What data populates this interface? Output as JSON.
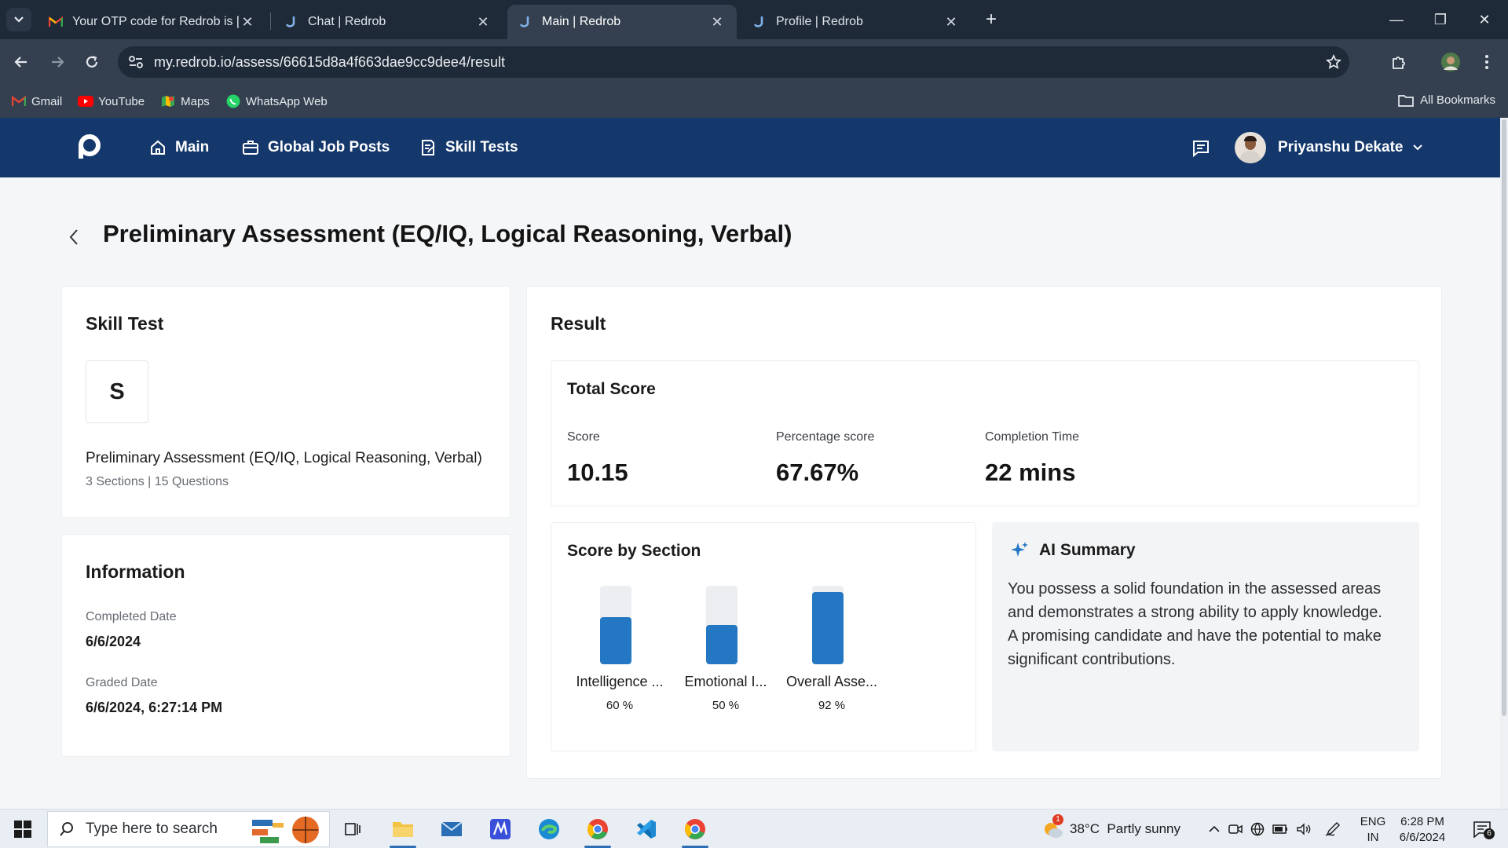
{
  "browser": {
    "tabs": [
      {
        "title": "Your OTP code for Redrob is [4",
        "favicon": "gmail-icon"
      },
      {
        "title": "Chat | Redrob",
        "favicon": "redrob-icon"
      },
      {
        "title": "Main | Redrob",
        "favicon": "redrob-icon"
      },
      {
        "title": "Profile | Redrob",
        "favicon": "redrob-icon"
      }
    ],
    "active_tab": 2,
    "url": "my.redrob.io/assess/66615d8a4f663dae9cc9dee4/result",
    "bookmarks": [
      {
        "label": "Gmail",
        "icon": "gmail-icon"
      },
      {
        "label": "YouTube",
        "icon": "youtube-icon"
      },
      {
        "label": "Maps",
        "icon": "maps-icon"
      },
      {
        "label": "WhatsApp Web",
        "icon": "whatsapp-icon"
      }
    ],
    "all_bookmarks": "All Bookmarks"
  },
  "app": {
    "nav": [
      {
        "label": "Main",
        "icon": "home-icon"
      },
      {
        "label": "Global Job Posts",
        "icon": "briefcase-icon"
      },
      {
        "label": "Skill Tests",
        "icon": "test-icon"
      }
    ],
    "user_name": "Priyanshu Dekate",
    "brand_color": "#14386b",
    "accent_color": "#2477c2"
  },
  "page": {
    "title": "Preliminary Assessment (EQ/IQ, Logical Reasoning, Verbal)"
  },
  "skill_test": {
    "heading": "Skill Test",
    "letter": "S",
    "name": "Preliminary Assessment (EQ/IQ, Logical Reasoning, Verbal)",
    "meta": "3 Sections | 15 Questions"
  },
  "information": {
    "heading": "Information",
    "completed_label": "Completed Date",
    "completed_value": "6/6/2024",
    "graded_label": "Graded Date",
    "graded_value": "6/6/2024, 6:27:14 PM"
  },
  "result": {
    "heading": "Result",
    "total_score": {
      "heading": "Total Score",
      "score_label": "Score",
      "score_value": "10.15",
      "percentage_label": "Percentage score",
      "percentage_value": "67.67%",
      "time_label": "Completion Time",
      "time_value": "22 mins"
    },
    "sections": {
      "heading": "Score by Section",
      "items": [
        {
          "label": "Intelligence ...",
          "pct_label": "60 %",
          "pct": 0.6
        },
        {
          "label": "Emotional I...",
          "pct_label": "50 %",
          "pct": 0.5
        },
        {
          "label": "Overall Asse...",
          "pct_label": "92 %",
          "pct": 0.92
        }
      ]
    },
    "ai_summary": {
      "heading": "AI Summary",
      "text": "You possess a solid foundation in the assessed areas and demonstrates a strong ability to apply knowledge. A promising candidate and have the potential to make significant contributions."
    }
  },
  "taskbar": {
    "search_placeholder": "Type here to search",
    "weather": "38°C  Partly sunny",
    "weather_badge": "1",
    "lang_1": "ENG",
    "lang_2": "IN",
    "time": "6:28 PM",
    "date": "6/6/2024",
    "notifications": "6"
  }
}
